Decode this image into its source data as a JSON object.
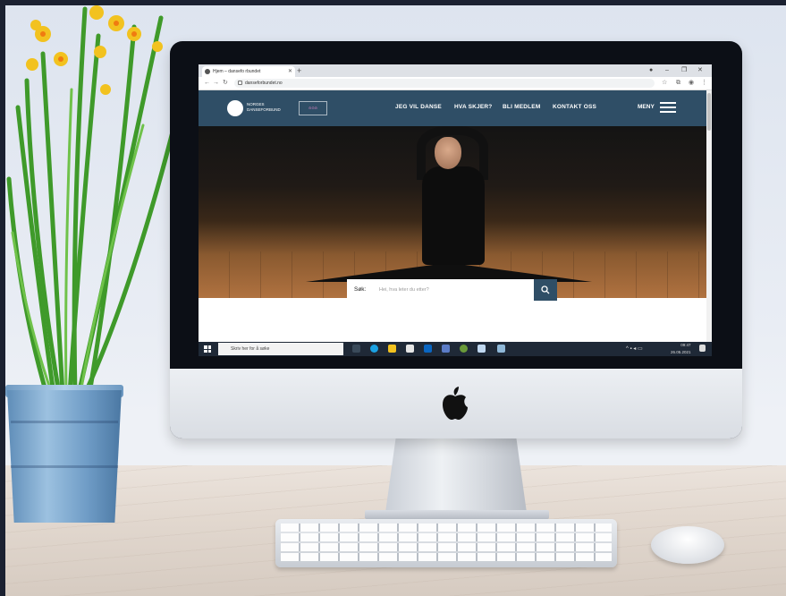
{
  "browser": {
    "tab_title": "Hjem – dansefo  rbundet",
    "new_tab": "+",
    "url": "danseforbundet.no",
    "window_controls": [
      "–",
      "❐",
      "✕"
    ]
  },
  "site": {
    "logo_line1": "NORGES",
    "logo_line2": "DANSEFORBUND",
    "nav": [
      "JEG VIL DANSE",
      "HVA SKJER?",
      "BLI MEDLEM",
      "KONTAKT OSS"
    ],
    "menu_label": "MENY",
    "search": {
      "label": "Søk:",
      "placeholder": "Hei, hva leter du etter?"
    }
  },
  "taskbar": {
    "search_placeholder": "Skriv her for å søke",
    "time": "09:47",
    "date": "26.05.2021"
  },
  "colors": {
    "site_header": "#2f4e66",
    "taskbar": "#1f2937"
  },
  "icons": [
    "windows-start-icon",
    "search-icon",
    "hamburger-menu-icon",
    "apple-logo-icon"
  ]
}
